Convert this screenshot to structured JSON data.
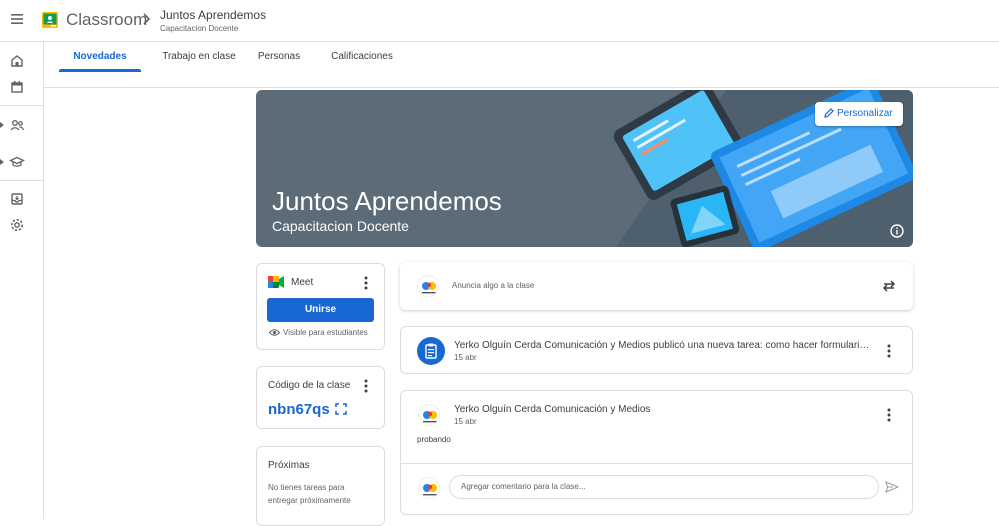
{
  "app": {
    "name": "Classroom",
    "breadcrumb_title": "Juntos Aprendemos",
    "breadcrumb_subtitle": "Capacitacion Docente",
    "menu_icon": "hamburger-menu-icon",
    "logo_icon": "classroom-logo-icon"
  },
  "sidebar": {
    "items": [
      {
        "icon": "home-icon"
      },
      {
        "icon": "calendar-icon"
      },
      {
        "icon": "people-icon"
      },
      {
        "icon": "graduation-cap-icon"
      },
      {
        "icon": "archive-icon"
      },
      {
        "icon": "settings-gear-icon"
      }
    ]
  },
  "tabs": [
    {
      "label": "Novedades",
      "active": true
    },
    {
      "label": "Trabajo en clase",
      "active": false
    },
    {
      "label": "Personas",
      "active": false
    },
    {
      "label": "Calificaciones",
      "active": false
    }
  ],
  "banner": {
    "title": "Juntos Aprendemos",
    "subtitle": "Capacitacion Docente",
    "customize_label": "Personalizar",
    "background_color": "#5b6b78"
  },
  "meet": {
    "label": "Meet",
    "join_label": "Unirse",
    "visibility_text": "Visible para estudiantes"
  },
  "class_code": {
    "label": "Código de la clase",
    "value": "nbn67qs"
  },
  "upcoming": {
    "label": "Próximas",
    "empty_text": "No tienes tareas para entregar próximamente"
  },
  "announce": {
    "placeholder": "Anuncia algo a la clase"
  },
  "stream": [
    {
      "title": "Yerko Olguín Cerda Comunicación y Medios publicó una nueva tarea: como hacer formulario...",
      "date": "15 abr"
    },
    {
      "author": "Yerko Olguín Cerda Comunicación y Medios",
      "date": "15 abr",
      "body": "probando",
      "comment_placeholder": "Agregar comentario para la clase..."
    }
  ],
  "colors": {
    "accent": "#1967d2",
    "meet_green": "#00832d"
  }
}
